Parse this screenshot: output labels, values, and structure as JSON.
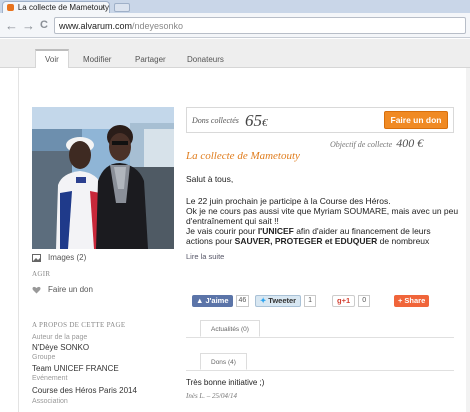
{
  "browser": {
    "tab_title": "La collecte de Mametouty",
    "tab_close": "×",
    "back": "←",
    "forward": "→",
    "reload": "C",
    "url_host": "www.alvarum.com",
    "url_path": "/ndeyesonko"
  },
  "page_tabs": [
    "Voir",
    "Modifier",
    "Partager",
    "Donateurs"
  ],
  "left": {
    "images_label": "Images (2)",
    "agir_title": "AGIR",
    "donate_link": "Faire un don",
    "about_title": "A PROPOS DE CETTE PAGE",
    "author_label": "Auteur de la page",
    "author_value": "N'Dèye SONKO",
    "group_label": "Groupe",
    "group_value": "Team UNICEF FRANCE",
    "event_label": "Evénement",
    "event_value": "Course des Héros Paris 2014",
    "association_label": "Association"
  },
  "donation": {
    "label": "Dons collectés",
    "amount": "65",
    "currency": "€",
    "button": "Faire un don",
    "goal_label": "Objectif de collecte",
    "goal_value": "400 €"
  },
  "campaign": {
    "title": "La collecte de Mametouty",
    "greeting": "Salut à tous,",
    "p1_l1": "Le 22 juin prochain je participe à la Course des Héros.",
    "p1_l2": "Ok je ne cours pas aussi vite que Myriam SOUMARE, mais avec un peu",
    "p1_l3": "d'entraînement qui sait !!",
    "p2_a": "Je vais courir pour ",
    "p2_b": "l'UNICEF",
    "p2_c": " afin d'aider au  financement de leurs",
    "p3_a": "actions pour ",
    "p3_b": "SAUVER, PROTEGER et EDUQUER",
    "p3_c": " de nombreux",
    "read_more": "Lire la suite"
  },
  "social": {
    "like_label": "J'aime",
    "like_count": "46",
    "tweet_label": "Tweeter",
    "tweet_count": "1",
    "gplus_label": "g+1",
    "gplus_count": "0",
    "share_label": "Share"
  },
  "feeds": {
    "news_tab": "Actualités (0)",
    "donations_tab": "Dons (4)"
  },
  "comment": {
    "text": "Très bonne initiative ;)",
    "meta": "Inès L. – 25/04/14"
  },
  "colors": {
    "accent": "#f08a24",
    "title_orange": "#e07d1e",
    "facebook": "#5b74a8",
    "twitter": "#d8e7f2",
    "gplus": "#ffffff",
    "share": "#f0653a"
  }
}
